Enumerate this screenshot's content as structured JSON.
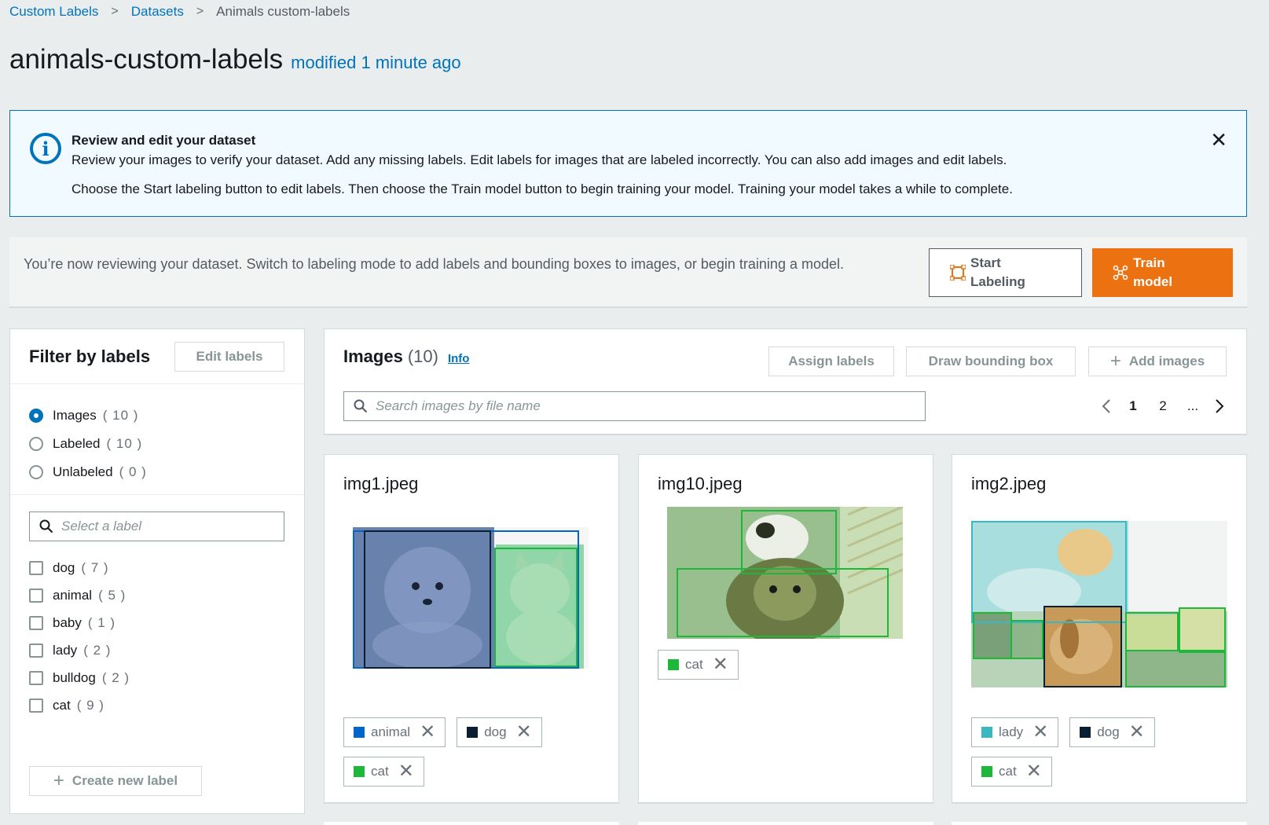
{
  "breadcrumb": {
    "items": [
      "Custom Labels",
      "Datasets",
      "Animals custom-labels"
    ]
  },
  "header": {
    "title": "animals-custom-labels",
    "modified": "modified 1 minute ago"
  },
  "banner": {
    "title": "Review and edit your dataset",
    "line1": "Review your images to verify your dataset. Add any missing labels. Edit labels for images that are labeled incorrectly. You can also add images and edit labels.",
    "line2": "Choose the Start labeling button to edit labels. Then choose the Train model button to begin training your model. Training your model takes a while to complete."
  },
  "review_bar": {
    "message": "You’re now reviewing your dataset. Switch to labeling mode to add labels and bounding boxes to images, or begin training a model.",
    "start_label": "Start Labeling",
    "train_label": "Train model"
  },
  "filter": {
    "title": "Filter by labels",
    "edit_labels": "Edit labels",
    "radios": [
      {
        "label": "Images",
        "count": "( 10 )",
        "selected": true
      },
      {
        "label": "Labeled",
        "count": "( 10 )",
        "selected": false
      },
      {
        "label": "Unlabeled",
        "count": "( 0 )",
        "selected": false
      }
    ],
    "search_placeholder": "Select a label",
    "labels": [
      {
        "label": "dog",
        "count": "( 7 )"
      },
      {
        "label": "animal",
        "count": "( 5 )"
      },
      {
        "label": "baby",
        "count": "( 1 )"
      },
      {
        "label": "lady",
        "count": "( 2 )"
      },
      {
        "label": "bulldog",
        "count": "( 2 )"
      },
      {
        "label": "cat",
        "count": "( 9 )"
      }
    ],
    "create_label": "Create new label"
  },
  "images": {
    "title": "Images",
    "count": "(10)",
    "info": "Info",
    "assign_labels": "Assign labels",
    "draw_bounding_box": "Draw bounding box",
    "add_images": "Add images",
    "search_placeholder": "Search images by file name",
    "pages": [
      "1",
      "2",
      "..."
    ],
    "current_page": "1"
  },
  "cards": [
    {
      "filename": "img1.jpeg",
      "tags": [
        {
          "label": "animal",
          "color": "#0066cc"
        },
        {
          "label": "dog",
          "color": "#0b1f33"
        },
        {
          "label": "cat",
          "color": "#1db83a"
        }
      ]
    },
    {
      "filename": "img10.jpeg",
      "tags": [
        {
          "label": "cat",
          "color": "#1db83a"
        }
      ]
    },
    {
      "filename": "img2.jpeg",
      "tags": [
        {
          "label": "lady",
          "color": "#3ab8c2"
        },
        {
          "label": "dog",
          "color": "#0b1f33"
        },
        {
          "label": "cat",
          "color": "#1db83a"
        }
      ]
    }
  ],
  "colors": {
    "accent": "#0073bb",
    "primary_button": "#ec7211",
    "background": "#eaeded"
  }
}
